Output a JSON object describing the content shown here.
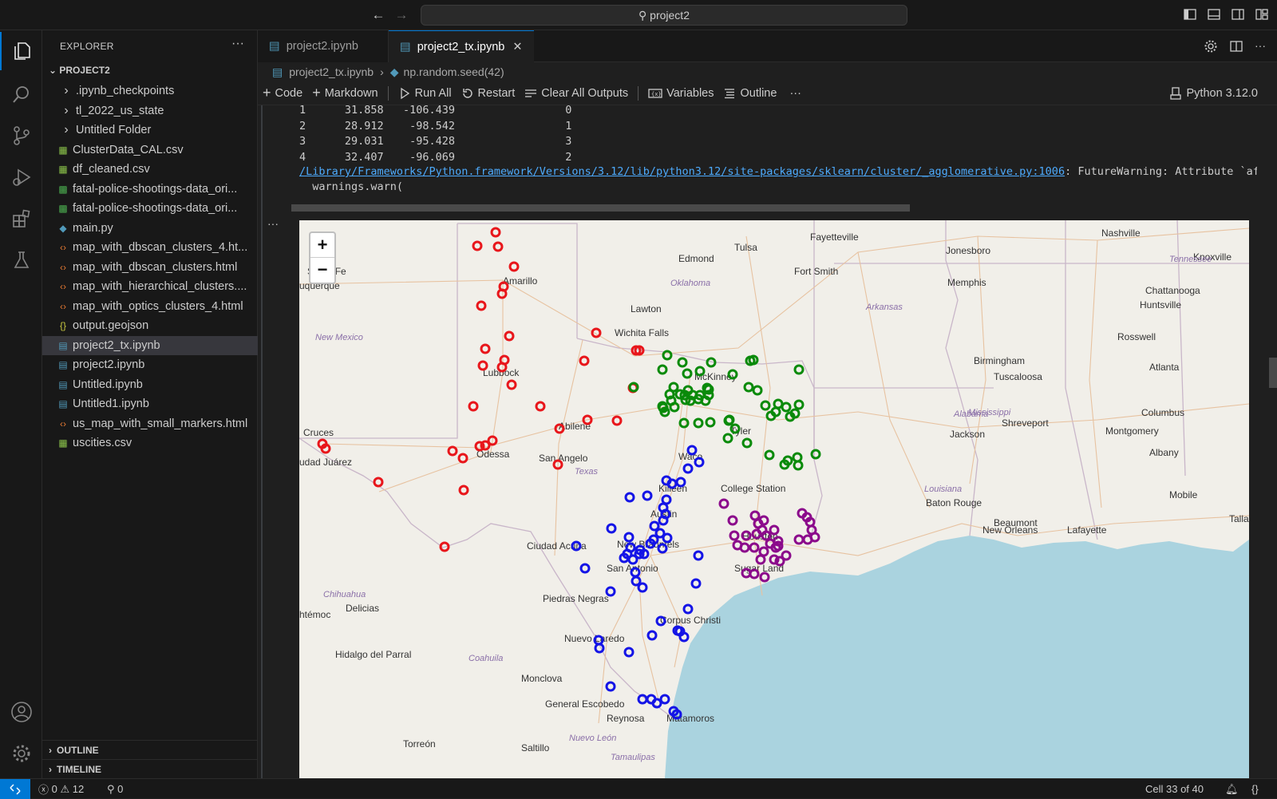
{
  "titlebar": {
    "search_text": "project2"
  },
  "sidebar": {
    "title": "EXPLORER",
    "root": "PROJECT2",
    "items": [
      {
        "label": ".ipynb_checkpoints",
        "kind": "folder"
      },
      {
        "label": "tl_2022_us_state",
        "kind": "folder"
      },
      {
        "label": "Untitled Folder",
        "kind": "folder"
      },
      {
        "label": "ClusterData_CAL.csv",
        "kind": "csv"
      },
      {
        "label": "df_cleaned.csv",
        "kind": "csv"
      },
      {
        "label": "fatal-police-shootings-data_ori...",
        "kind": "excel"
      },
      {
        "label": "fatal-police-shootings-data_ori...",
        "kind": "excel"
      },
      {
        "label": "main.py",
        "kind": "python"
      },
      {
        "label": "map_with_dbscan_clusters_4.ht...",
        "kind": "html"
      },
      {
        "label": "map_with_dbscan_clusters.html",
        "kind": "html"
      },
      {
        "label": "map_with_hierarchical_clusters....",
        "kind": "html"
      },
      {
        "label": "map_with_optics_clusters_4.html",
        "kind": "html"
      },
      {
        "label": "output.geojson",
        "kind": "json"
      },
      {
        "label": "project2_tx.ipynb",
        "kind": "notebook",
        "selected": true
      },
      {
        "label": "project2.ipynb",
        "kind": "notebook"
      },
      {
        "label": "Untitled.ipynb",
        "kind": "notebook"
      },
      {
        "label": "Untitled1.ipynb",
        "kind": "notebook"
      },
      {
        "label": "us_map_with_small_markers.html",
        "kind": "html"
      },
      {
        "label": "uscities.csv",
        "kind": "csv"
      }
    ],
    "outline_label": "OUTLINE",
    "timeline_label": "TIMELINE"
  },
  "tabs": [
    {
      "label": "project2.ipynb",
      "active": false
    },
    {
      "label": "project2_tx.ipynb",
      "active": true
    }
  ],
  "breadcrumb": {
    "file": "project2_tx.ipynb",
    "symbol": "np.random.seed(42)"
  },
  "toolbar": {
    "code": "Code",
    "markdown": "Markdown",
    "run_all": "Run All",
    "restart": "Restart",
    "clear_outputs": "Clear All Outputs",
    "variables": "Variables",
    "outline": "Outline",
    "kernel": "Python 3.12.0"
  },
  "output": {
    "rows": [
      {
        "idx": "1",
        "lat": "31.858",
        "lon": "-106.439",
        "cluster": "0"
      },
      {
        "idx": "2",
        "lat": "28.912",
        "lon": "-98.542",
        "cluster": "1"
      },
      {
        "idx": "3",
        "lat": "29.031",
        "lon": "-95.428",
        "cluster": "3"
      },
      {
        "idx": "4",
        "lat": "32.407",
        "lon": "-96.069",
        "cluster": "2"
      }
    ],
    "warning_path": "/Library/Frameworks/Python.framework/Versions/3.12/lib/python3.12/site-packages/sklearn/cluster/_agglomerative.py:1006",
    "warning_text": ": FutureWarning: Attribute `affinity` was deprecated",
    "warning_call": "  warnings.warn("
  },
  "map": {
    "zoom_in": "+",
    "zoom_out": "−",
    "cluster_colors": {
      "red": "#e8161b",
      "green": "#0a8a0a",
      "blue": "#1414e6",
      "purple": "#8b0a8b"
    },
    "labels": {
      "cities": [
        "Tulsa",
        "Fayetteville",
        "Nashville",
        "Edmond",
        "Jonesboro",
        "Knoxville",
        "Santa Fe",
        "Amarillo",
        "Fort Smith",
        "Memphis",
        "Chattanooga",
        "uquerque",
        "Lawton",
        "Huntsville",
        "Wichita Falls",
        "Birmingham",
        "Atlanta",
        "Rosswell",
        "Lubbock",
        "McKinney",
        "Tuscaloosa",
        "Shreveport",
        "Columbus",
        "Abilene",
        "Tyler",
        "Montgomery",
        "Cruces",
        "udad Juárez",
        "San Angelo",
        "Jackson",
        "Albany",
        "Waco",
        "Killeen",
        "College Station",
        "Austin",
        "Baton Rouge",
        "Mobile",
        "Tallahassee",
        "Beaumont",
        "Lafayette",
        "New Orleans",
        "Ciudad Acuña",
        "New Braunfels",
        "San Antonio",
        "Houston",
        "Sugar Land",
        "Piedras Negras",
        "Delicias",
        "htémoc",
        "Corpus Christi",
        "Nuevo Laredo",
        "Hidalgo del Parral",
        "Monclova",
        "General Escobedo",
        "Reynosa",
        "Matamoros",
        "Torreón",
        "Saltillo",
        "Odessa"
      ],
      "regions": [
        "New Mexico",
        "Oklahoma",
        "Arkansas",
        "Tennessee",
        "Mississippi",
        "Alabama",
        "Texas",
        "Louisiana",
        "Chihuahua",
        "Coahuila",
        "Nuevo León",
        "Tamaulipas"
      ]
    }
  },
  "status": {
    "errors": "0",
    "warnings": "12",
    "ports": "0",
    "cell": "Cell 33 of 40"
  }
}
